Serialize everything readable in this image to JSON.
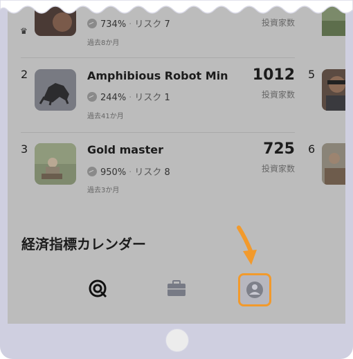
{
  "rows_top": {
    "partial": {
      "return": "734%",
      "risk_label": "リスク",
      "risk": "7",
      "investors_label": "投資家数",
      "period": "過去8か月"
    }
  },
  "rows": [
    {
      "rank": "2",
      "name": "Amphibious Robot Min",
      "return": "244%",
      "risk_label": "リスク",
      "risk": "1",
      "period": "過去41か月",
      "investors": "1012",
      "investors_label": "投資家数",
      "side_rank": "5"
    },
    {
      "rank": "3",
      "name": "Gold master",
      "return": "950%",
      "risk_label": "リスク",
      "risk": "8",
      "period": "過去3か月",
      "investors": "725",
      "investors_label": "投資家数",
      "side_rank": "6"
    }
  ],
  "section": {
    "title": "経済指標カレンダー"
  },
  "tabbar": {
    "items": [
      {
        "icon": "search-target-icon"
      },
      {
        "icon": "briefcase-icon"
      },
      {
        "icon": "profile-icon",
        "active": true
      }
    ]
  },
  "colors": {
    "accent": "#f29a2c",
    "overlay": "#bcbcbc"
  }
}
